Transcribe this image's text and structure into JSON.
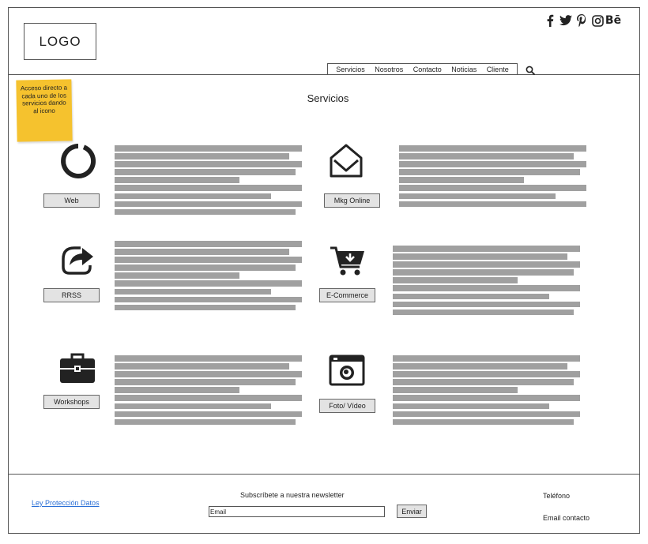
{
  "header": {
    "logo_text": "LOGO",
    "social": [
      "facebook-icon",
      "twitter-icon",
      "pinterest-icon",
      "instagram-icon",
      "behance-icon"
    ],
    "behance_text": "Bē",
    "nav": [
      "Servicios",
      "Nosotros",
      "Contacto",
      "Noticias",
      "Cliente"
    ]
  },
  "note": {
    "text": "Acceso directo a cada uno de los servicios dando al icono"
  },
  "main": {
    "title": "Servicios",
    "services": [
      {
        "label": "Web",
        "icon": "loading-circle-icon"
      },
      {
        "label": "Mkg Online",
        "icon": "envelope-open-icon"
      },
      {
        "label": "RRSS",
        "icon": "share-arrow-icon"
      },
      {
        "label": "E-Commerce",
        "icon": "shopping-cart-icon"
      },
      {
        "label": "Workshops",
        "icon": "briefcase-icon"
      },
      {
        "label": "Foto/ Vídeo",
        "icon": "camera-icon"
      }
    ]
  },
  "footer": {
    "privacy_link": "Ley Protección Datos",
    "newsletter_title": "Subscríbete a nuestra newsletter",
    "email_placeholder": "Email",
    "send_label": "Enviar",
    "phone_label": "Teléfono",
    "email_contact_label": "Email contacto"
  },
  "colors": {
    "sticky_note": "#f5c22e",
    "placeholder_bar": "#a0a0a0",
    "button_bg": "#e3e3e3",
    "link": "#2a6fd6"
  }
}
